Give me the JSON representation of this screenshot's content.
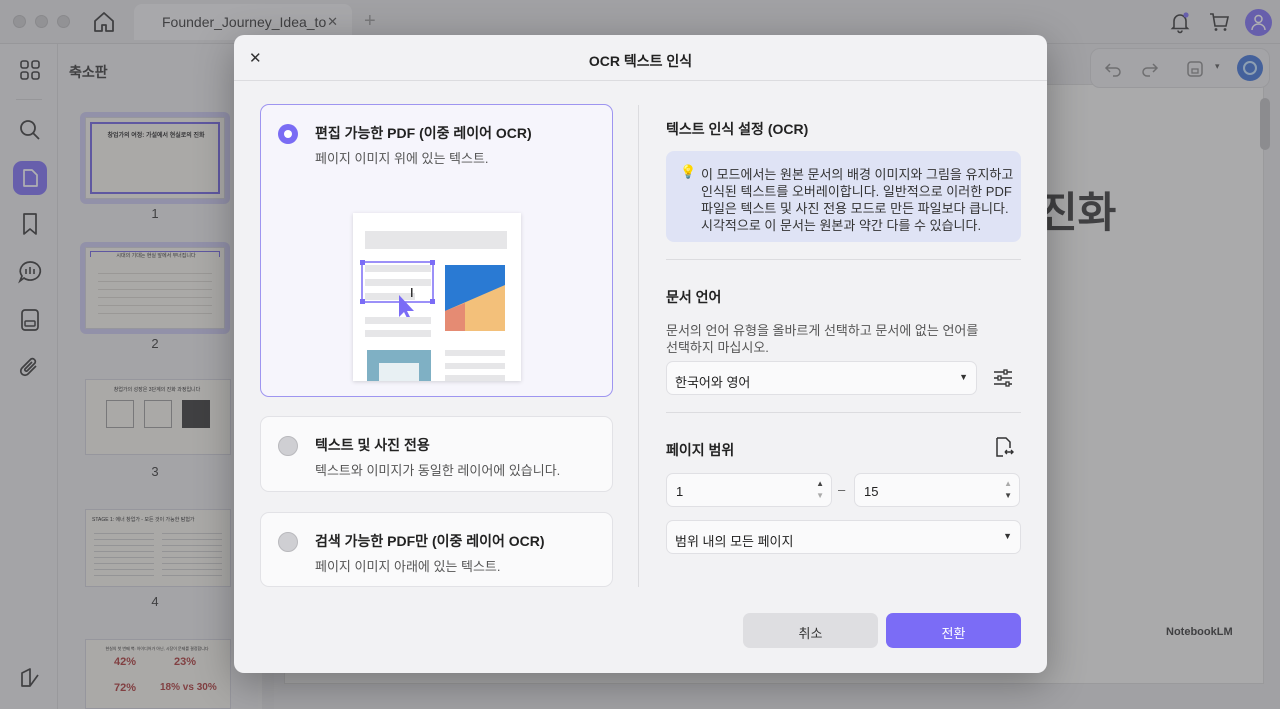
{
  "tab": {
    "title": "Founder_Journey_Idea_to",
    "close": "✕",
    "new": "+"
  },
  "sidebar": {
    "thumb_title": "축소판"
  },
  "thumbnails": [
    {
      "num": "1",
      "text": "창업가의 여정: 가설에서 현실로의 진화"
    },
    {
      "num": "2",
      "text": "시대의 기대는 현실 앞에서 무너집니다"
    },
    {
      "num": "3",
      "text": "창업가의 성장은 3단계의 진화 과정입니다"
    },
    {
      "num": "4",
      "text": "STAGE 1: 에너 창업가 - 모든 것이 가능한 탐험가"
    },
    {
      "num": "",
      "text": "현실의 첫 번째 벽: 아이디어가 아닌, 시장이 문제를 결정합니다",
      "stats": [
        "42%",
        "23%",
        "72%",
        "18% vs 30%"
      ]
    }
  ],
  "background": {
    "title_fragment": "진화",
    "brand": "NotebookLM"
  },
  "dialog": {
    "close": "✕",
    "title": "OCR 텍스트 인식",
    "options": [
      {
        "title": "편집 가능한 PDF (이중 레이어 OCR)",
        "desc": "페이지 이미지 위에 있는 텍스트.",
        "selected": true
      },
      {
        "title": "텍스트 및 사진 전용",
        "desc": "텍스트와 이미지가 동일한 레이어에 있습니다.",
        "selected": false
      },
      {
        "title": "검색 가능한 PDF만 (이중 레이어 OCR)",
        "desc": "페이지 이미지 아래에 있는 텍스트.",
        "selected": false
      }
    ],
    "settings_title": "텍스트 인식 설정 (OCR)",
    "info_lines": [
      "이 모드에서는 원본 문서의 배경 이미지와 그림을 유지하고",
      "인식된 텍스트를 오버레이합니다. 일반적으로 이러한 PDF",
      "파일은 텍스트 및 사진 전용 모드로 만든 파일보다 큽니다.",
      "시각적으로 이 문서는 원본과 약간 다를 수 있습니다."
    ],
    "language": {
      "title": "문서 언어",
      "help_lines": [
        "문서의 언어 유형을 올바르게 선택하고 문서에 없는 언어를",
        "선택하지 마십시오."
      ],
      "value": "한국어와 영어"
    },
    "page_range": {
      "title": "페이지 범위",
      "from": "1",
      "to": "15",
      "separator": "–",
      "subset": "범위 내의 모든 페이지"
    },
    "cancel": "취소",
    "convert": "전환"
  },
  "colors": {
    "accent": "#7b6cf6",
    "info_bg": "#dfe3f5"
  }
}
